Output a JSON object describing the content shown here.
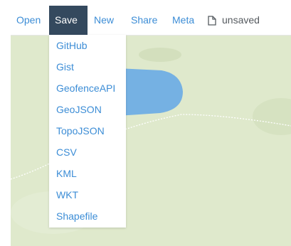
{
  "menu": {
    "open": "Open",
    "save": "Save",
    "new": "New",
    "share": "Share",
    "meta": "Meta",
    "status": "unsaved"
  },
  "save_menu": {
    "items": [
      "GitHub",
      "Gist",
      "GeofenceAPI",
      "GeoJSON",
      "TopoJSON",
      "CSV",
      "KML",
      "WKT",
      "Shapefile"
    ]
  },
  "colors": {
    "accent": "#3c8dd6",
    "active_bg": "#34495e",
    "map_land": "#dfe9cc",
    "map_water": "#75b1e3"
  },
  "icons": {
    "file": "file-icon"
  }
}
